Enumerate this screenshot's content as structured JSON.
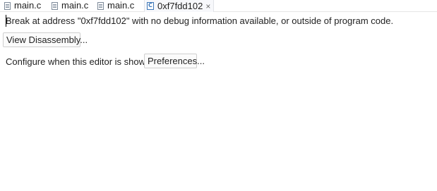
{
  "tabs": [
    {
      "label": "main.c",
      "icon": "c-file-icon"
    },
    {
      "label": "main.c",
      "icon": "c-file-icon"
    },
    {
      "label": "main.c",
      "icon": "c-file-icon"
    },
    {
      "label": "0xf7fdd102",
      "icon": "disassembly-file-icon",
      "active": true,
      "close_glyph": "×"
    }
  ],
  "editor": {
    "message": "Break at address \"0xf7fdd102\" with no debug information available, or outside of program code.",
    "view_disassembly_label": "View Disassembly...",
    "configure_text": "Configure when this editor is shown",
    "preferences_label": "Preferences..."
  },
  "colors": {
    "background": "#ffffff",
    "active_tab": "#f7f8fb",
    "button_border": "#cfcfcf"
  }
}
